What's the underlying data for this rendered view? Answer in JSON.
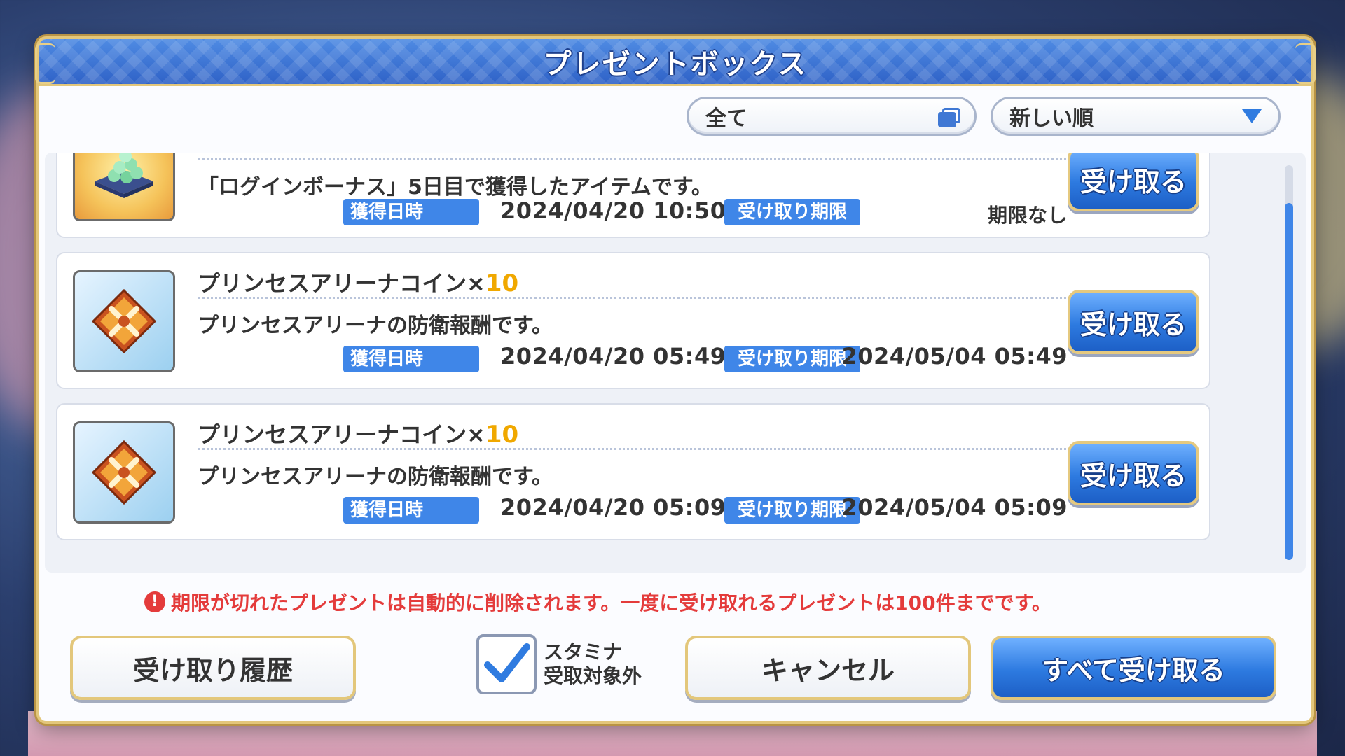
{
  "modal": {
    "title": "プレゼントボックス"
  },
  "filter": {
    "selected": "全て",
    "icon": "copy-icon"
  },
  "sort": {
    "selected": "新しい順",
    "icon": "triangle-down-icon"
  },
  "labels": {
    "acquired": "獲得日時",
    "deadline": "受け取り期限",
    "receive": "受け取る"
  },
  "items": [
    {
      "name": "",
      "quantity": "",
      "description": "「ログインボーナス」5日目で獲得したアイテムです。",
      "acquired_at": "2024/04/20 10:50",
      "deadline": "期限なし",
      "icon": "gem-pile-icon"
    },
    {
      "name": "プリンセスアリーナコイン×",
      "quantity": "10",
      "description": "プリンセスアリーナの防衛報酬です。",
      "acquired_at": "2024/04/20 05:49",
      "deadline": "2024/05/04 05:49",
      "icon": "arena-coin-icon"
    },
    {
      "name": "プリンセスアリーナコイン×",
      "quantity": "10",
      "description": "プリンセスアリーナの防衛報酬です。",
      "acquired_at": "2024/04/20 05:09",
      "deadline": "2024/05/04 05:09",
      "icon": "arena-coin-icon"
    }
  ],
  "notice": "期限が切れたプレゼントは自動的に削除されます。一度に受け取れるプレゼントは100件までです。",
  "footer": {
    "history": "受け取り履歴",
    "stamina_line1": "スタミナ",
    "stamina_line2": "受取対象外",
    "stamina_checked": true,
    "cancel": "キャンセル",
    "receive_all": "すべて受け取る"
  },
  "colors": {
    "header_blue": "#2f62c7",
    "tag_blue": "#3f86e8",
    "gold_border": "#e3c77b",
    "notice_red": "#e43b3b",
    "quantity_orange": "#f0a800"
  }
}
